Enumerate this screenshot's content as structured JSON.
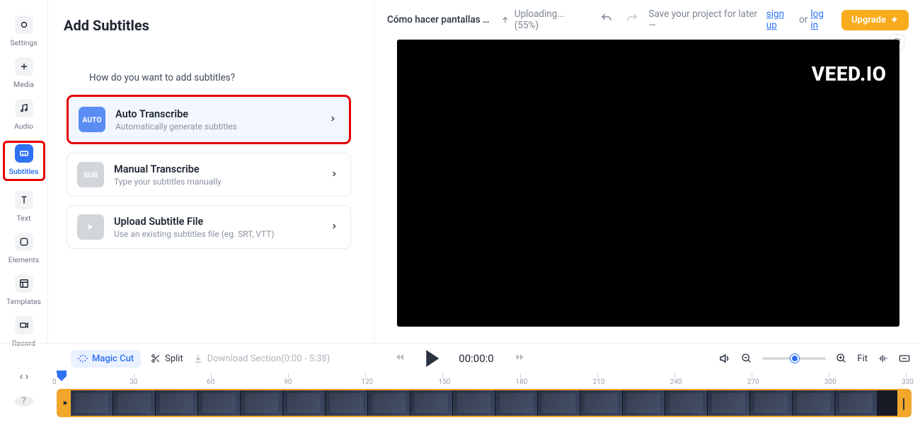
{
  "sidebar": {
    "items": [
      {
        "label": "Settings"
      },
      {
        "label": "Media"
      },
      {
        "label": "Audio"
      },
      {
        "label": "Subtitles"
      },
      {
        "label": "Text"
      },
      {
        "label": "Elements"
      },
      {
        "label": "Templates"
      },
      {
        "label": "Record"
      }
    ]
  },
  "panel": {
    "title": "Add Subtitles",
    "question": "How do you want to add subtitles?",
    "options": [
      {
        "badge": "AUTO",
        "title": "Auto Transcribe",
        "desc": "Automatically generate subtitles"
      },
      {
        "badge": "SUB",
        "title": "Manual Transcribe",
        "desc": "Type your subtitles manually"
      },
      {
        "badge": "",
        "title": "Upload Subtitle File",
        "desc": "Use an existing subtitles file (eg. SRT, VTT)"
      }
    ]
  },
  "header": {
    "project": "Cómo hacer pantallas fi…",
    "uploading": "Uploading... (55%)",
    "save_text": "Save your project for later —",
    "signup": "sign up",
    "or": "or",
    "login": "log in",
    "upgrade": "Upgrade",
    "watermark": "VEED.IO"
  },
  "controls": {
    "magic": "Magic Cut",
    "split": "Split",
    "download": "Download Section(0:00 - 5:38)",
    "time": "00:00:0",
    "fit": "Fit"
  },
  "timeline": {
    "ticks": [
      0,
      30,
      60,
      90,
      120,
      150,
      180,
      210,
      240,
      270,
      300,
      330
    ]
  }
}
